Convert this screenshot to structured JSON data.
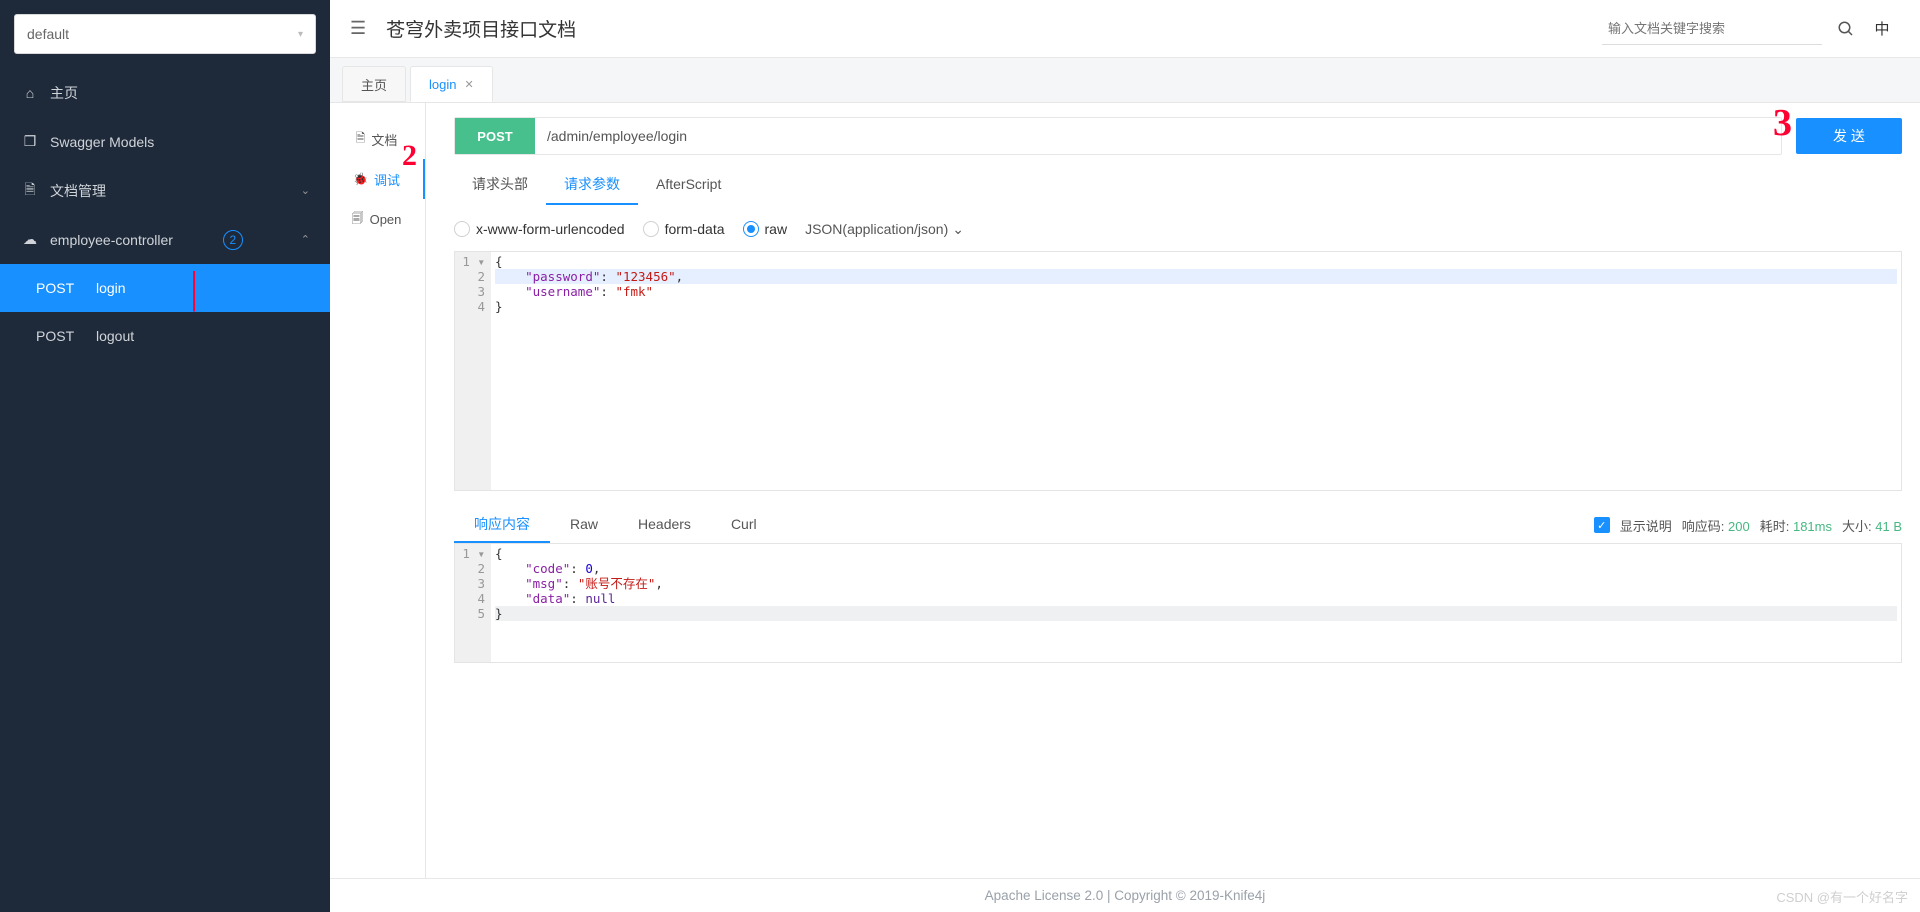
{
  "sidebar": {
    "group": "default",
    "home": "主页",
    "models": "Swagger Models",
    "docmgr": "文档管理",
    "controller": "employee-controller",
    "badge": "2",
    "items": [
      {
        "method": "POST",
        "name": "login"
      },
      {
        "method": "POST",
        "name": "logout"
      }
    ]
  },
  "header": {
    "title": "苍穹外卖项目接口文档",
    "search_placeholder": "输入文档关键字搜索",
    "lang": "中"
  },
  "tabs": [
    {
      "label": "主页"
    },
    {
      "label": "login"
    }
  ],
  "mini": {
    "doc": "文档",
    "debug": "调试",
    "open": "Open"
  },
  "request": {
    "method": "POST",
    "url": "/admin/employee/login",
    "send": "发 送",
    "tabs": [
      "请求头部",
      "请求参数",
      "AfterScript"
    ],
    "body_types": [
      "x-www-form-urlencoded",
      "form-data",
      "raw"
    ],
    "content_type": "JSON(application/json)",
    "body": {
      "password": "\"123456\"",
      "username": "\"fmk\""
    }
  },
  "response": {
    "tabs": [
      "响应内容",
      "Raw",
      "Headers",
      "Curl"
    ],
    "show_desc": "显示说明",
    "status_label": "响应码:",
    "status": "200",
    "time_label": "耗时:",
    "time": "181ms",
    "size_label": "大小:",
    "size": "41 B",
    "body": {
      "code": "0",
      "msg": "\"账号不存在\"",
      "data": "null"
    }
  },
  "footer": {
    "text": "Apache License 2.0 | Copyright © 2019-Knife4j",
    "watermark": "CSDN @有一个好名字"
  },
  "annotations": {
    "a1": "|",
    "a2": "2",
    "a3": "3"
  }
}
